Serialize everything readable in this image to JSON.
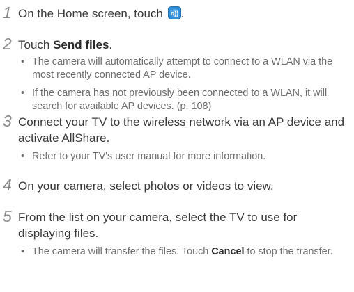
{
  "steps": [
    {
      "num": "1",
      "text_pre": "On the Home screen, touch ",
      "text_post": ".",
      "icon": "allshare-app-icon"
    },
    {
      "num": "2",
      "text_pre": "Touch ",
      "bold": "Send files",
      "text_post": ".",
      "bullets": [
        "The camera will automatically attempt to connect to a WLAN via the most recently connected AP device.",
        "If the camera has not previously been connected to a WLAN, it will search for available AP devices. (p. 108)"
      ]
    },
    {
      "num": "3",
      "text": "Connect your TV to the wireless network via an AP device and activate AllShare.",
      "bullets": [
        "Refer to your TV's user manual for more information."
      ]
    },
    {
      "num": "4",
      "text": "On your camera, select photos or videos to view."
    },
    {
      "num": "5",
      "text": "From the list on your camera, select the TV to use for displaying files.",
      "bullet_pre": "The camera will transfer the files. Touch ",
      "bullet_bold": "Cancel",
      "bullet_post": " to stop the transfer."
    }
  ],
  "bullet_glyph": "•",
  "colors": {
    "icon_blue": "#2f8fd8",
    "number_gray": "#8a8a8a",
    "bullet_gray": "#6d6d6d"
  }
}
